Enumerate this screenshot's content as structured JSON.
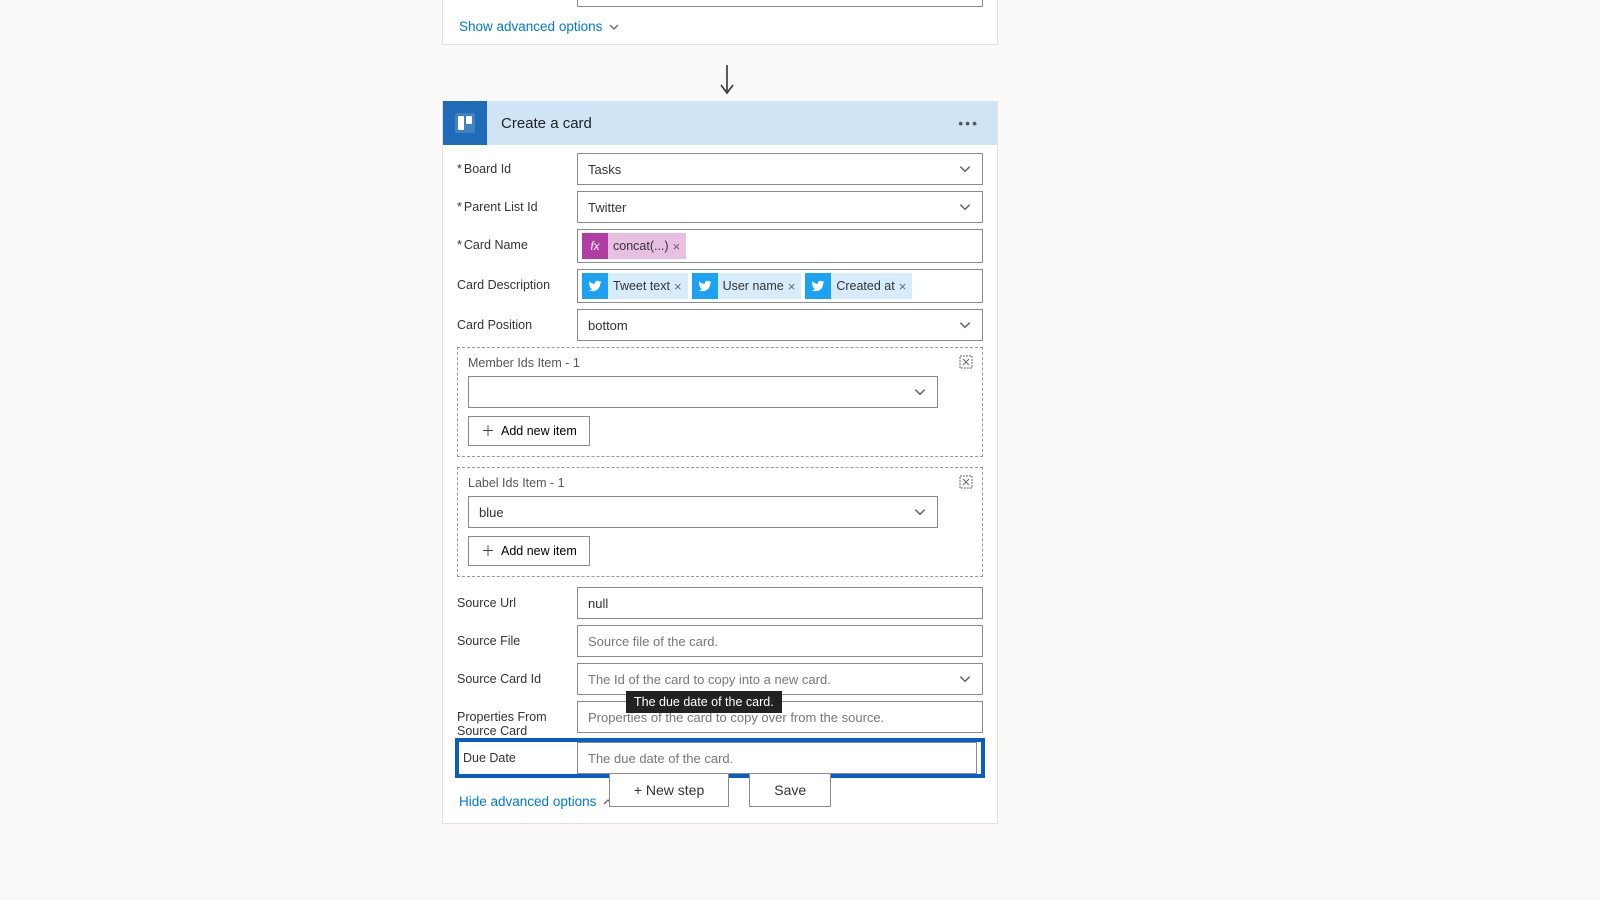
{
  "top_card": {
    "advanced_label": "Show advanced options"
  },
  "action": {
    "title": "Create a card",
    "fields": {
      "board_id": {
        "label": "Board Id",
        "value": "Tasks"
      },
      "parent_list": {
        "label": "Parent List Id",
        "value": "Twitter"
      },
      "card_name": {
        "label": "Card Name",
        "tokens": [
          {
            "type": "fx",
            "text": "concat(...)"
          }
        ]
      },
      "card_desc": {
        "label": "Card Description",
        "tokens": [
          {
            "type": "tw",
            "text": "Tweet text"
          },
          {
            "type": "tw",
            "text": "User name"
          },
          {
            "type": "tw",
            "text": "Created at"
          }
        ]
      },
      "card_pos": {
        "label": "Card Position",
        "value": "bottom"
      },
      "member_ids": {
        "label": "Member Ids Item - 1",
        "add_label": "Add new item"
      },
      "label_ids": {
        "label": "Label Ids Item - 1",
        "value": "blue",
        "add_label": "Add new item"
      },
      "source_url": {
        "label": "Source Url",
        "value": "null"
      },
      "source_file": {
        "label": "Source File",
        "placeholder": "Source file of the card."
      },
      "source_card": {
        "label": "Source Card Id",
        "placeholder": "The Id of the card to copy into a new card."
      },
      "props_source": {
        "label": "Properties From Source Card",
        "placeholder": "Properties of the card to copy over from the source."
      },
      "due_date": {
        "label": "Due Date",
        "placeholder": "The due date of the card.",
        "tooltip": "The due date of the card."
      }
    },
    "hide_label": "Hide advanced options"
  },
  "footer": {
    "new_step": "+ New step",
    "save": "Save"
  }
}
